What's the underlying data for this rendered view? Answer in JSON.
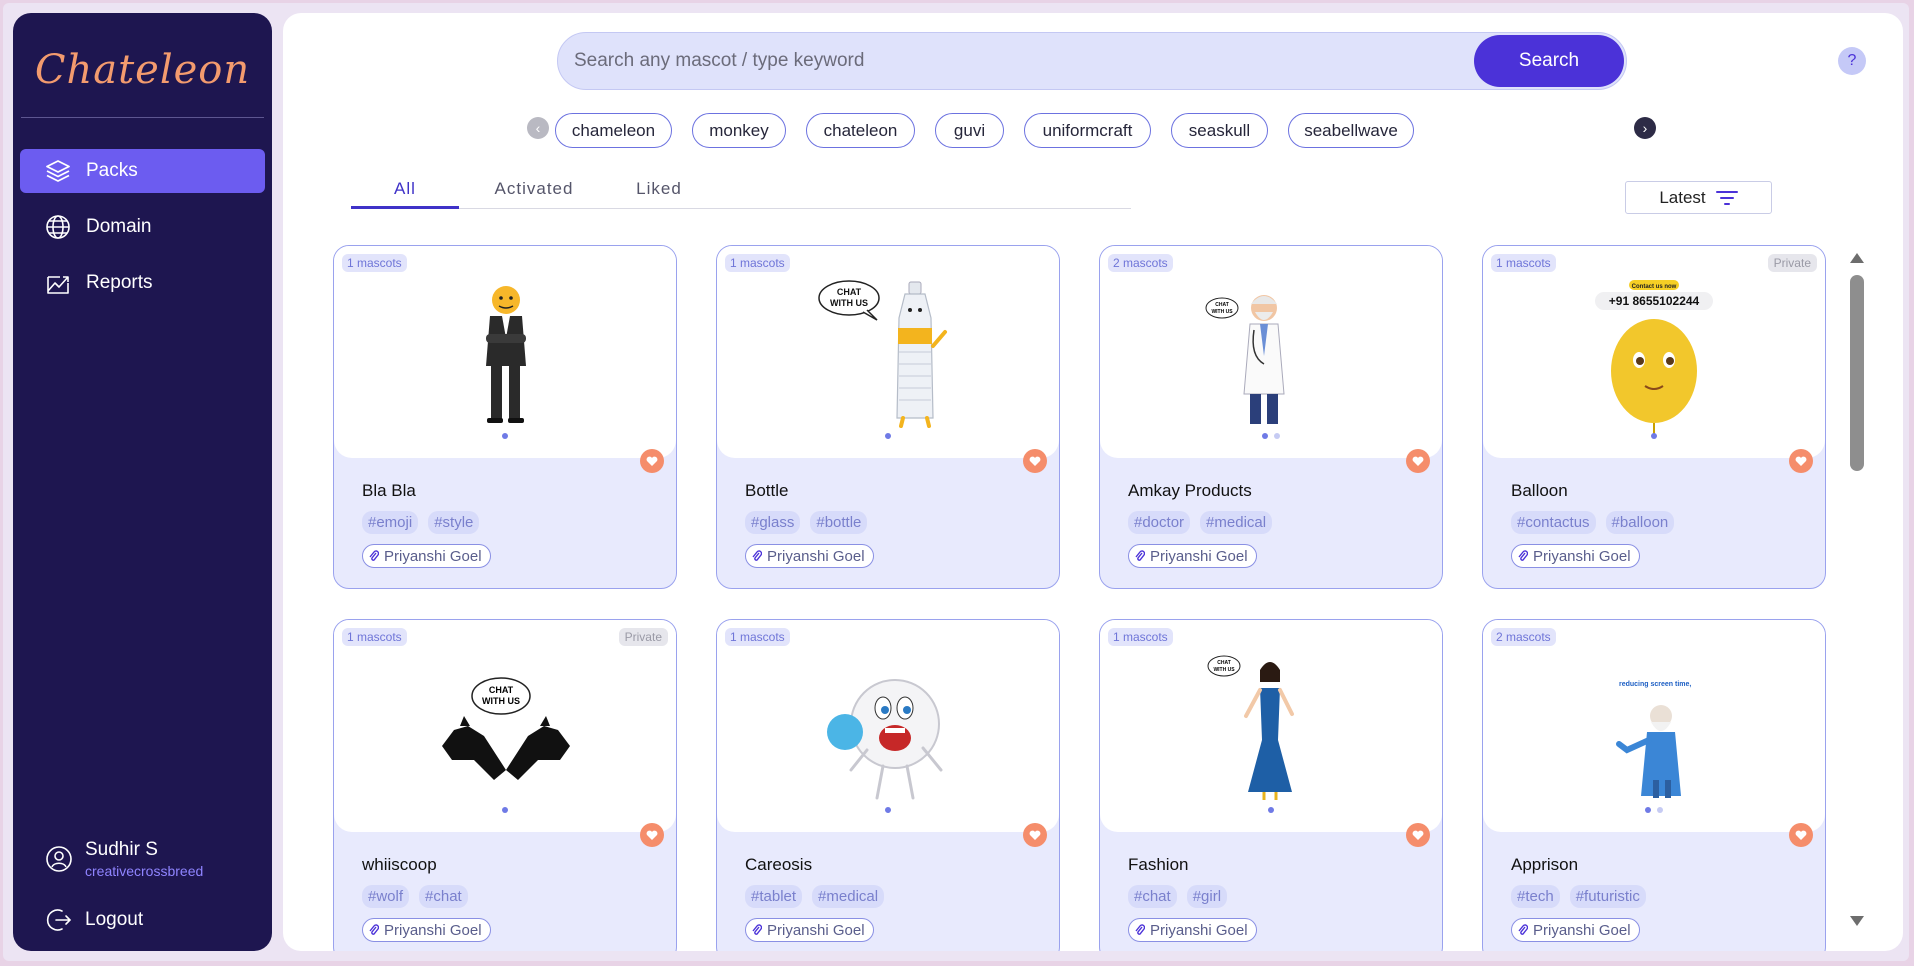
{
  "app": {
    "logo": "Chateleon"
  },
  "sidebar": {
    "items": [
      {
        "label": "Packs",
        "icon": "layers-icon",
        "active": true
      },
      {
        "label": "Domain",
        "icon": "globe-icon",
        "active": false
      },
      {
        "label": "Reports",
        "icon": "chart-image-icon",
        "active": false
      }
    ],
    "user": {
      "name": "Sudhir S",
      "org": "creativecrossbreed"
    },
    "logout_label": "Logout"
  },
  "search": {
    "placeholder": "Search any mascot / type keyword",
    "button_label": "Search"
  },
  "help_label": "?",
  "keywords": [
    "chameleon",
    "monkey",
    "chateleon",
    "guvi",
    "uniformcraft",
    "seaskull",
    "seabellwave"
  ],
  "tabs": [
    "All",
    "Activated",
    "Liked"
  ],
  "active_tab": "All",
  "sort": {
    "label": "Latest"
  },
  "colors": {
    "sidebar": "#1e1650",
    "accent": "#4b32d8",
    "active_nav": "#6c5cf0",
    "like": "#f58d6b"
  },
  "cards": [
    {
      "count": "1 mascots",
      "private": "",
      "title": "Bla Bla",
      "tags": [
        "#emoji",
        "#style"
      ],
      "author": "Priyanshi Goel"
    },
    {
      "count": "1 mascots",
      "private": "",
      "title": "Bottle",
      "tags": [
        "#glass",
        "#bottle"
      ],
      "author": "Priyanshi Goel",
      "bubble": [
        "CHAT",
        "WITH US"
      ]
    },
    {
      "count": "2 mascots",
      "private": "",
      "title": "Amkay Products",
      "tags": [
        "#doctor",
        "#medical"
      ],
      "author": "Priyanshi Goel",
      "bubble": [
        "CHAT",
        "WITH US"
      ]
    },
    {
      "count": "1 mascots",
      "private": "Private",
      "title": "Balloon",
      "tags": [
        "#contactus",
        "#balloon"
      ],
      "author": "Priyanshi Goel",
      "banner": "Contact us now",
      "phone": "+91 8655102244"
    },
    {
      "count": "1 mascots",
      "private": "Private",
      "title": "whiiscoop",
      "tags": [
        "#wolf",
        "#chat"
      ],
      "author": "Priyanshi Goel",
      "bubble": [
        "CHAT",
        "WITH US"
      ]
    },
    {
      "count": "1 mascots",
      "private": "",
      "title": "Careosis",
      "tags": [
        "#tablet",
        "#medical"
      ],
      "author": "Priyanshi Goel"
    },
    {
      "count": "1 mascots",
      "private": "",
      "title": "Fashion",
      "tags": [
        "#chat",
        "#girl"
      ],
      "author": "Priyanshi Goel",
      "bubble": [
        "CHAT",
        "WITH US"
      ]
    },
    {
      "count": "2 mascots",
      "private": "",
      "title": "Apprison",
      "tags": [
        "#tech",
        "#futuristic"
      ],
      "author": "Priyanshi Goel",
      "caption": "reducing screen time,"
    }
  ]
}
